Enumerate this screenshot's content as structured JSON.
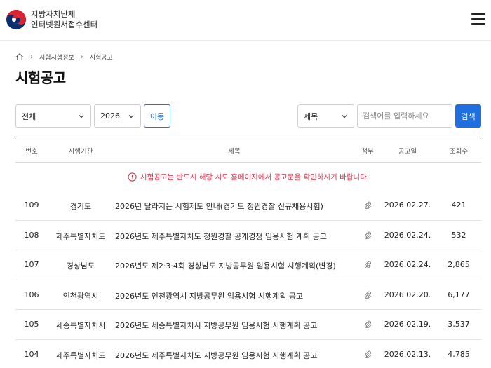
{
  "header": {
    "org_line1": "지방자치단체",
    "org_line2": "인터넷원서접수센터",
    "menu_icon": "hamburger-menu-icon"
  },
  "breadcrumb": {
    "home_icon": "home-icon",
    "items": [
      "시험시행정보",
      "시험공고"
    ]
  },
  "page_title": "시험공고",
  "filters": {
    "region_value": "전체",
    "year_value": "2026",
    "go_label": "이동",
    "field_value": "제목",
    "search_placeholder": "검색어를 입력하세요",
    "search_label": "검색"
  },
  "table": {
    "headers": {
      "no": "번호",
      "org": "시행기관",
      "title": "제목",
      "attach": "첨부",
      "date": "공고일",
      "views": "조회수"
    },
    "notice": "시험공고는 반드시 해당 시도 홈페이지에서 공고문을 확인하시기 바랍니다.",
    "rows": [
      {
        "no": "109",
        "org": "경기도",
        "title": "2026년 달라지는 시험제도 안내(경기도 청원경찰 신규채용시험)",
        "date": "2026.02.27.",
        "views": "421"
      },
      {
        "no": "108",
        "org": "제주특별자치도",
        "title": "2026년도 제주특별자치도 청원경찰 공개경쟁 임용시험 계획 공고",
        "date": "2026.02.24.",
        "views": "532"
      },
      {
        "no": "107",
        "org": "경상남도",
        "title": "2026년도 제2·3·4회 경상남도 지방공무원 임용시험 시행계획(변경)",
        "date": "2026.02.24.",
        "views": "2,865"
      },
      {
        "no": "106",
        "org": "인천광역시",
        "title": "2026년도 인천광역시 지방공무원 임용시험 시행계획 공고",
        "date": "2026.02.20.",
        "views": "6,177"
      },
      {
        "no": "105",
        "org": "세종특별자치시",
        "title": "2026년도 세종특별자치시 지방공무원 임용시험 시행계획 공고",
        "date": "2026.02.19.",
        "views": "3,537"
      },
      {
        "no": "104",
        "org": "제주특별자치도",
        "title": "2026년도 제주특별자치도 지방공무원 임용시험 시행계획 공고",
        "date": "2026.02.13.",
        "views": "4,785"
      }
    ]
  },
  "colors": {
    "accent": "#1f6fe0",
    "notice": "#e0314b"
  }
}
